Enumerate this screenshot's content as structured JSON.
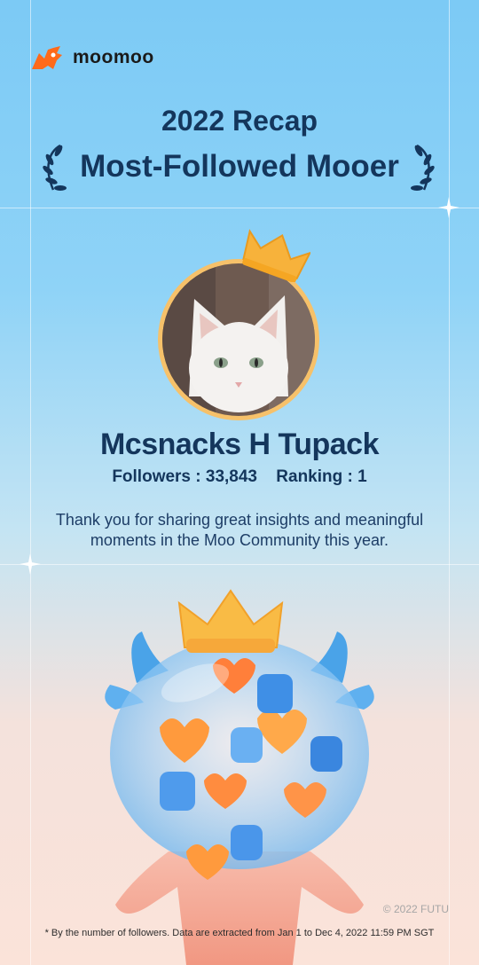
{
  "brand": {
    "name": "moomoo",
    "accent": "#ff6a1a"
  },
  "header": {
    "recap_title": "2022 Recap",
    "award_title": "Most-Followed Mooer"
  },
  "profile": {
    "name": "Mcsnacks H Tupack",
    "followers_label": "Followers : 33,843",
    "ranking_label": "Ranking : 1"
  },
  "message": "Thank you for sharing great insights and meaningful moments in the Moo Community this year.",
  "footer": {
    "copyright": "© 2022 FUTU",
    "footnote": "* By the number of followers. Data are extracted from Jan 1 to Dec 4, 2022 11:59 PM SGT"
  },
  "icons": {
    "logo": "moomoo-bull-logo-icon",
    "laurel_left": "laurel-left-icon",
    "laurel_right": "laurel-right-icon",
    "crown": "crown-icon",
    "mascot": "mascot-bull-illustration"
  }
}
